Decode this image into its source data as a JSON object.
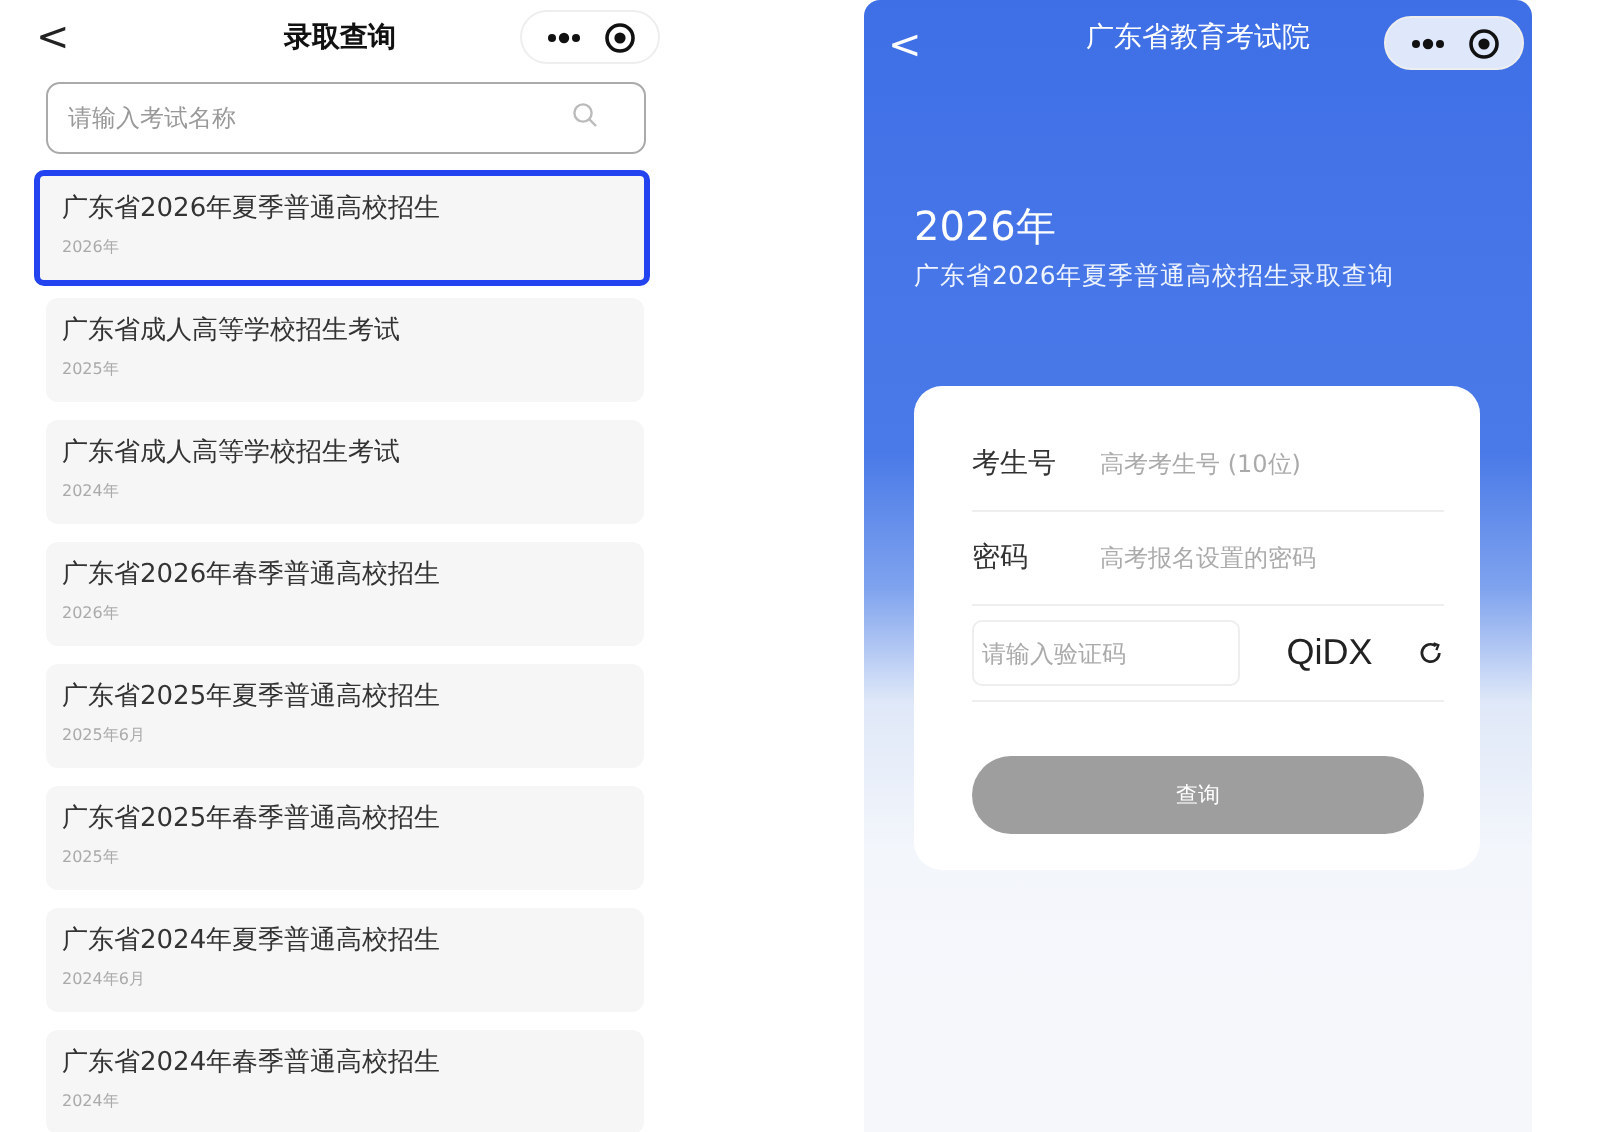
{
  "left_screen": {
    "nav": {
      "back": "<",
      "title": "录取查询"
    },
    "search": {
      "placeholder": "请输入考试名称"
    },
    "exams": [
      {
        "title": "广东省2026年夏季普通高校招生",
        "date": "2026年",
        "selected": true
      },
      {
        "title": "广东省成人高等学校招生考试",
        "date": "2025年",
        "selected": false
      },
      {
        "title": "广东省成人高等学校招生考试",
        "date": "2024年",
        "selected": false
      },
      {
        "title": "广东省2026年春季普通高校招生",
        "date": "2026年",
        "selected": false
      },
      {
        "title": "广东省2025年夏季普通高校招生",
        "date": "2025年6月",
        "selected": false
      },
      {
        "title": "广东省2025年春季普通高校招生",
        "date": "2025年",
        "selected": false
      },
      {
        "title": "广东省2024年夏季普通高校招生",
        "date": "2024年6月",
        "selected": false
      },
      {
        "title": "广东省2024年春季普通高校招生",
        "date": "2024年",
        "selected": false
      }
    ]
  },
  "right_screen": {
    "nav": {
      "back": "<",
      "title": "广东省教育考试院"
    },
    "year": "2026年",
    "subtitle": "广东省2026年夏季普通高校招生录取查询",
    "form": {
      "fields": [
        {
          "label": "考生号",
          "placeholder": "高考考生号 (10位)"
        },
        {
          "label": "密码",
          "placeholder": "高考报名设置的密码"
        }
      ],
      "captcha": {
        "placeholder": "请输入验证码",
        "code": "QiDX"
      },
      "submit": {
        "label": "查询",
        "disabled": true
      }
    }
  }
}
